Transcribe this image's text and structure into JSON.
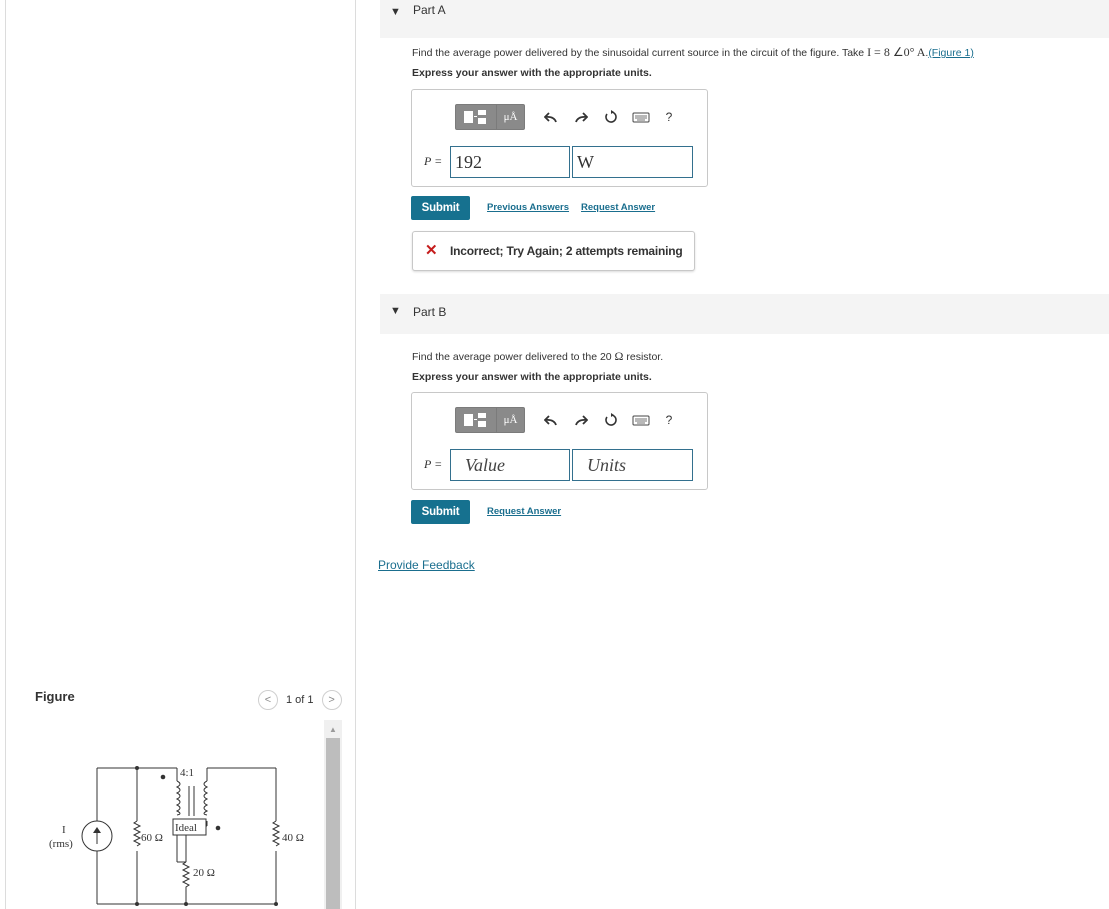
{
  "part_a": {
    "header": "Part A",
    "question_pre": "Find the average power delivered by the sinusoidal current source in the circuit of the figure. Take ",
    "question_math": "I = 8 ∠0° A",
    "question_dot": ".",
    "figure_link": "(Figure 1)",
    "instruction": "Express your answer with the appropriate units.",
    "var_label": "P =",
    "value": "192",
    "units": "W",
    "submit": "Submit",
    "previous_answers": "Previous Answers",
    "request_answer": "Request Answer",
    "feedback": "Incorrect; Try Again; 2 attempts remaining"
  },
  "part_b": {
    "header": "Part B",
    "question_pre": "Find the average power delivered to the 20 ",
    "question_ohm": "Ω",
    "question_post": " resistor.",
    "instruction": "Express your answer with the appropriate units.",
    "var_label": "P =",
    "value_placeholder": "Value",
    "units_placeholder": "Units",
    "submit": "Submit",
    "request_answer": "Request Answer"
  },
  "toolbar": {
    "units_label": "μÅ",
    "help": "?",
    "icons": [
      "templates-icon",
      "undo-icon",
      "redo-icon",
      "reset-icon",
      "keyboard-icon",
      "help-icon"
    ]
  },
  "provide_feedback": "Provide Feedback",
  "figure": {
    "label": "Figure",
    "pager": "1 of 1",
    "prev": "<",
    "next": ">",
    "circuit": {
      "source_label": "I",
      "source_sublabel": "(rms)",
      "ratio": "4:1",
      "ideal": "Ideal",
      "r60": "60 Ω",
      "r40": "40 Ω",
      "r20": "20 Ω"
    }
  },
  "colors": {
    "accent": "#16718f",
    "link": "#1a6e8e",
    "error": "#c51c1c"
  }
}
